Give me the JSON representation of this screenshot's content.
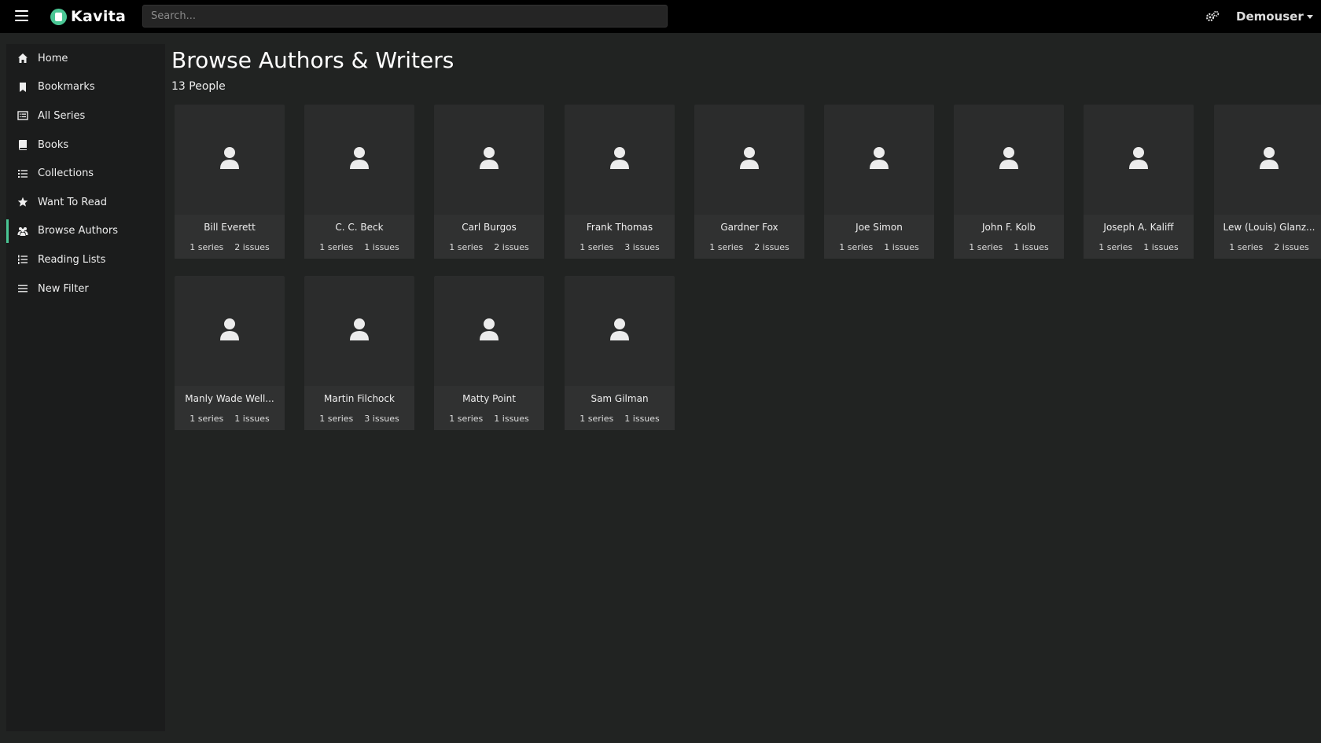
{
  "app": {
    "brand": "Kavita",
    "user": "Demouser"
  },
  "search": {
    "placeholder": "Search..."
  },
  "sidebar": {
    "items": [
      {
        "label": "Home",
        "icon": "home-icon"
      },
      {
        "label": "Bookmarks",
        "icon": "bookmark-icon"
      },
      {
        "label": "All Series",
        "icon": "list-alt-icon"
      },
      {
        "label": "Books",
        "icon": "book-icon"
      },
      {
        "label": "Collections",
        "icon": "list-icon"
      },
      {
        "label": "Want To Read",
        "icon": "star-icon"
      },
      {
        "label": "Browse Authors",
        "icon": "users-icon",
        "active": true
      },
      {
        "label": "Reading Lists",
        "icon": "list-ol-icon"
      },
      {
        "label": "New Filter",
        "icon": "filter-lines-icon"
      }
    ]
  },
  "main": {
    "title": "Browse Authors & Writers",
    "subtitle": "13 People"
  },
  "authors": [
    {
      "name": "Bill Everett",
      "series": "1 series",
      "issues": "2 issues"
    },
    {
      "name": "C. C. Beck",
      "series": "1 series",
      "issues": "1 issues"
    },
    {
      "name": "Carl Burgos",
      "series": "1 series",
      "issues": "2 issues"
    },
    {
      "name": "Frank Thomas",
      "series": "1 series",
      "issues": "3 issues"
    },
    {
      "name": "Gardner Fox",
      "series": "1 series",
      "issues": "2 issues"
    },
    {
      "name": "Joe Simon",
      "series": "1 series",
      "issues": "1 issues"
    },
    {
      "name": "John F. Kolb",
      "series": "1 series",
      "issues": "1 issues"
    },
    {
      "name": "Joseph A. Kaliff",
      "series": "1 series",
      "issues": "1 issues"
    },
    {
      "name": "Lew (Louis) Glanz...",
      "series": "1 series",
      "issues": "2 issues"
    },
    {
      "name": "Manly Wade Well...",
      "series": "1 series",
      "issues": "1 issues"
    },
    {
      "name": "Martin Filchock",
      "series": "1 series",
      "issues": "3 issues"
    },
    {
      "name": "Matty Point",
      "series": "1 series",
      "issues": "1 issues"
    },
    {
      "name": "Sam Gilman",
      "series": "1 series",
      "issues": "1 issues"
    }
  ],
  "colors": {
    "accent": "#4ac694",
    "topbar": "#000000",
    "background": "#212322",
    "card": "#2b2c2c"
  }
}
